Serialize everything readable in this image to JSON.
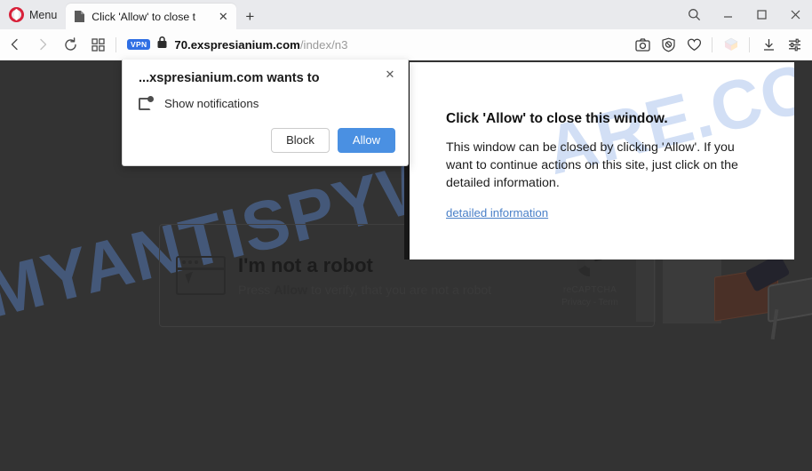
{
  "browser": {
    "menu_label": "Menu",
    "tab": {
      "title": "Click 'Allow' to close t",
      "close_icon": "close-icon",
      "favicon": "page-favicon"
    },
    "new_tab_label": "+",
    "window_controls": {
      "search": "⌕",
      "minimize": "–",
      "maximize": "□",
      "close": "✕"
    },
    "nav": {
      "back": "‹",
      "forward": "›",
      "reload": "⟳",
      "speeddial": "speed-dial-icon"
    },
    "omnibox": {
      "vpn_badge": "VPN",
      "lock_icon": "lock-icon",
      "url_host": "70.exspresianium.com",
      "url_path": "/index/n3"
    },
    "toolbar_right": {
      "snapshot": "camera-icon",
      "adblock": "shield-block-icon",
      "heart": "heart-icon",
      "extension": "extension-cube-icon",
      "downloads": "download-icon",
      "easy_setup": "easy-setup-icon"
    }
  },
  "permission_popup": {
    "title": "...xspresianium.com wants to",
    "permission_label": "Show notifications",
    "block_label": "Block",
    "allow_label": "Allow",
    "close_label": "✕",
    "accent_color": "#4a90e2"
  },
  "overlay": {
    "title": "Click 'Allow' to close this window.",
    "body": "This window can be closed by clicking 'Allow'. If you want to continue actions on this site, just click on the detailed information.",
    "link": "detailed information",
    "link_color": "#4a80c8",
    "watermark": "ARE.COM"
  },
  "page": {
    "background_color": "#333333",
    "watermark": "MYANTISPYWARE.COM",
    "captcha": {
      "title": "I'm not a robot",
      "subtitle_pre": "Press ",
      "subtitle_strong": "Allow",
      "subtitle_post": " to verify, that you are not a robot",
      "icon": "browser-window-cursor-icon",
      "recaptcha": {
        "name": "reCAPTCHA",
        "links": "Privacy - Term",
        "logo": "recaptcha-logo-icon"
      }
    },
    "illustration": "office-desk-briefcase-illustration"
  }
}
